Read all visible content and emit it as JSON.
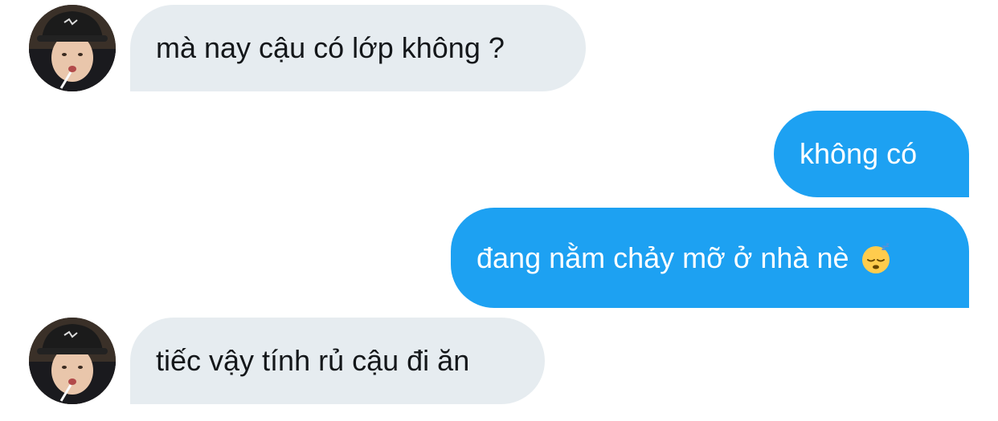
{
  "conversation": {
    "messages": [
      {
        "sender": "other",
        "text": "mà nay cậu có lớp không ?"
      },
      {
        "sender": "me",
        "text": "không có"
      },
      {
        "sender": "me",
        "text": "đang nằm chảy mỡ ở nhà nè",
        "emoji": "sleeping-face-emoji"
      },
      {
        "sender": "other",
        "text": "tiếc vậy tính rủ cậu đi ăn"
      }
    ]
  },
  "colors": {
    "incoming_bubble": "#e6ecf0",
    "outgoing_bubble": "#1da1f2",
    "incoming_text": "#14171a",
    "outgoing_text": "#ffffff",
    "background": "#ffffff"
  }
}
